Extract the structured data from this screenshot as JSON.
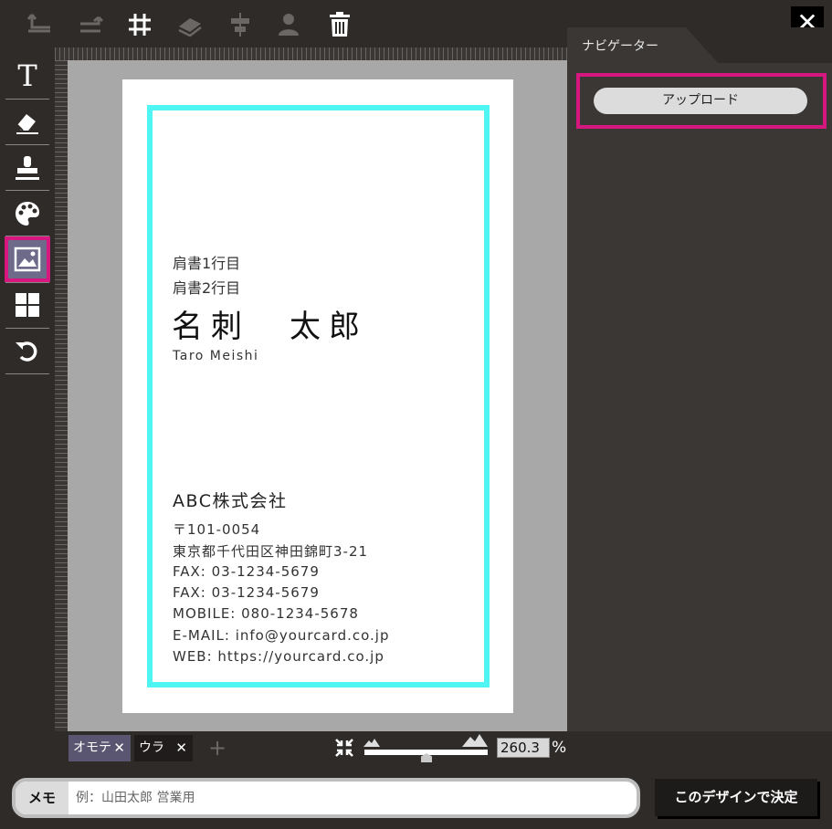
{
  "toolbar": {
    "icons": [
      "undo-icon",
      "redo-icon",
      "grid-icon",
      "layer-icon",
      "align-center-icon",
      "user-icon",
      "trash-icon"
    ],
    "close_label": "✕"
  },
  "left_tools": [
    "text-icon",
    "eraser-icon",
    "stamp-icon",
    "palette-icon",
    "image-icon",
    "layout-icon",
    "rotate-icon"
  ],
  "card": {
    "title_line1": "肩書1行目",
    "title_line2": "肩書2行目",
    "name": "名刺　太郎",
    "name_roman": "Taro Meishi",
    "company": "ABC株式会社",
    "address_lines": [
      "〒101-0054",
      "東京都千代田区神田錦町3-21",
      "FAX: 03-1234-5679",
      "FAX: 03-1234-5679",
      "MOBILE: 080-1234-5678",
      "E-MAIL: info@yourcard.co.jp",
      "WEB: https://yourcard.co.jp"
    ],
    "frame_color": "#4ff5f2"
  },
  "navigator": {
    "tab_label": "ナビゲーター",
    "upload_label": "アップロード",
    "highlight_color": "#d6177f"
  },
  "pages": {
    "front_label": "オモテ",
    "back_label": "ウラ",
    "close_symbol": "✕",
    "add_symbol": "+"
  },
  "zoom": {
    "value": "260.3",
    "unit": "%"
  },
  "memo": {
    "label": "メモ",
    "placeholder": "例：山田太郎 営業用",
    "value": ""
  },
  "decide_label": "このデザインで決定"
}
